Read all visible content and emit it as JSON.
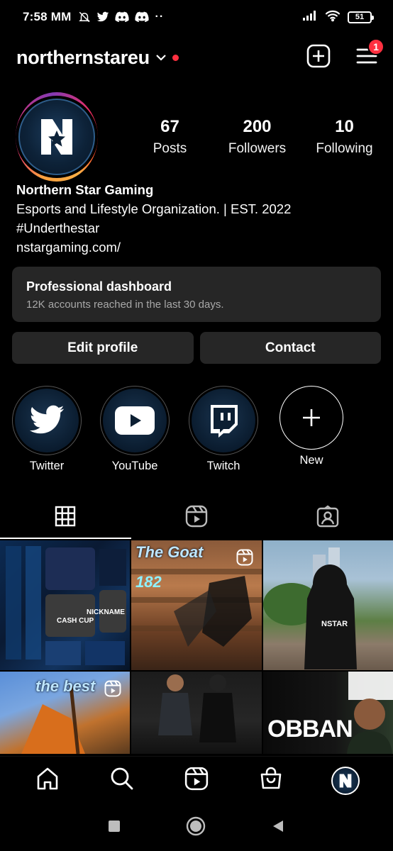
{
  "status_bar": {
    "time": "7:58 MM",
    "battery": "51"
  },
  "header": {
    "username": "northernstareu",
    "notification_count": "1"
  },
  "profile": {
    "stats": [
      {
        "value": "67",
        "label": "Posts"
      },
      {
        "value": "200",
        "label": "Followers"
      },
      {
        "value": "10",
        "label": "Following"
      }
    ],
    "name": "Northern Star Gaming",
    "bio_line1": "Esports and Lifestyle Organization. | EST. 2022",
    "bio_line2": "#Underthestar",
    "link": "nstargaming.com/"
  },
  "dashboard": {
    "title": "Professional dashboard",
    "subtitle": "12K accounts reached in the last 30 days."
  },
  "buttons": {
    "edit_profile": "Edit profile",
    "contact": "Contact"
  },
  "highlights": [
    {
      "label": "Twitter",
      "icon": "twitter-icon"
    },
    {
      "label": "YouTube",
      "icon": "youtube-icon"
    },
    {
      "label": "Twitch",
      "icon": "twitch-icon"
    },
    {
      "label": "New",
      "icon": "plus-icon"
    }
  ],
  "tabs": [
    {
      "icon": "grid-icon",
      "active": true
    },
    {
      "icon": "reels-icon",
      "active": false
    },
    {
      "icon": "tagged-icon",
      "active": false
    }
  ],
  "grid": {
    "captions": [
      "The Goat",
      "182",
      "the best",
      "OBBAN",
      "NICKNAME",
      "CASH CUP",
      "NSTAR"
    ]
  },
  "colors": {
    "background": "#000000",
    "surface": "#262626",
    "accent_red": "#ff3040",
    "secondary_text": "#a8a8a8"
  }
}
